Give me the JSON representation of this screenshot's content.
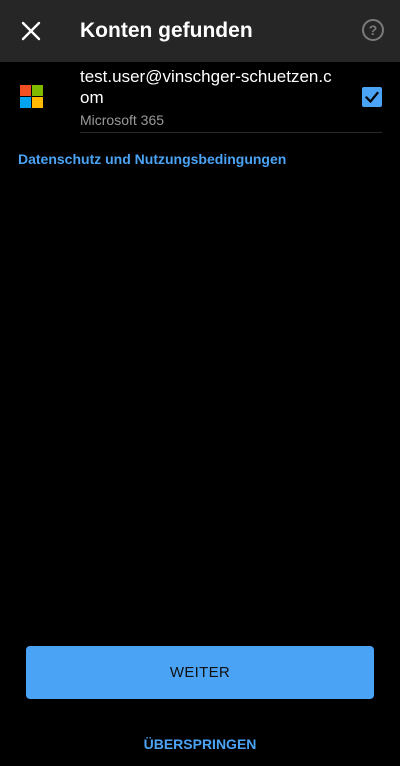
{
  "header": {
    "title": "Konten gefunden",
    "close_icon": "close-icon",
    "help_icon": "help-icon",
    "help_glyph": "?",
    "background": "#262626"
  },
  "account": {
    "email": "test.user@vinschger-schuetzen.com",
    "type": "Microsoft 365",
    "logo": "microsoft-logo",
    "checked": true
  },
  "links": {
    "privacy": "Datenschutz und Nutzungsbedingungen"
  },
  "actions": {
    "continue_label": "WEITER",
    "skip_label": "ÜBERSPRINGEN"
  },
  "colors": {
    "accent": "#4aa3f5",
    "background": "#000000",
    "secondary_text": "#9a9a9a"
  }
}
